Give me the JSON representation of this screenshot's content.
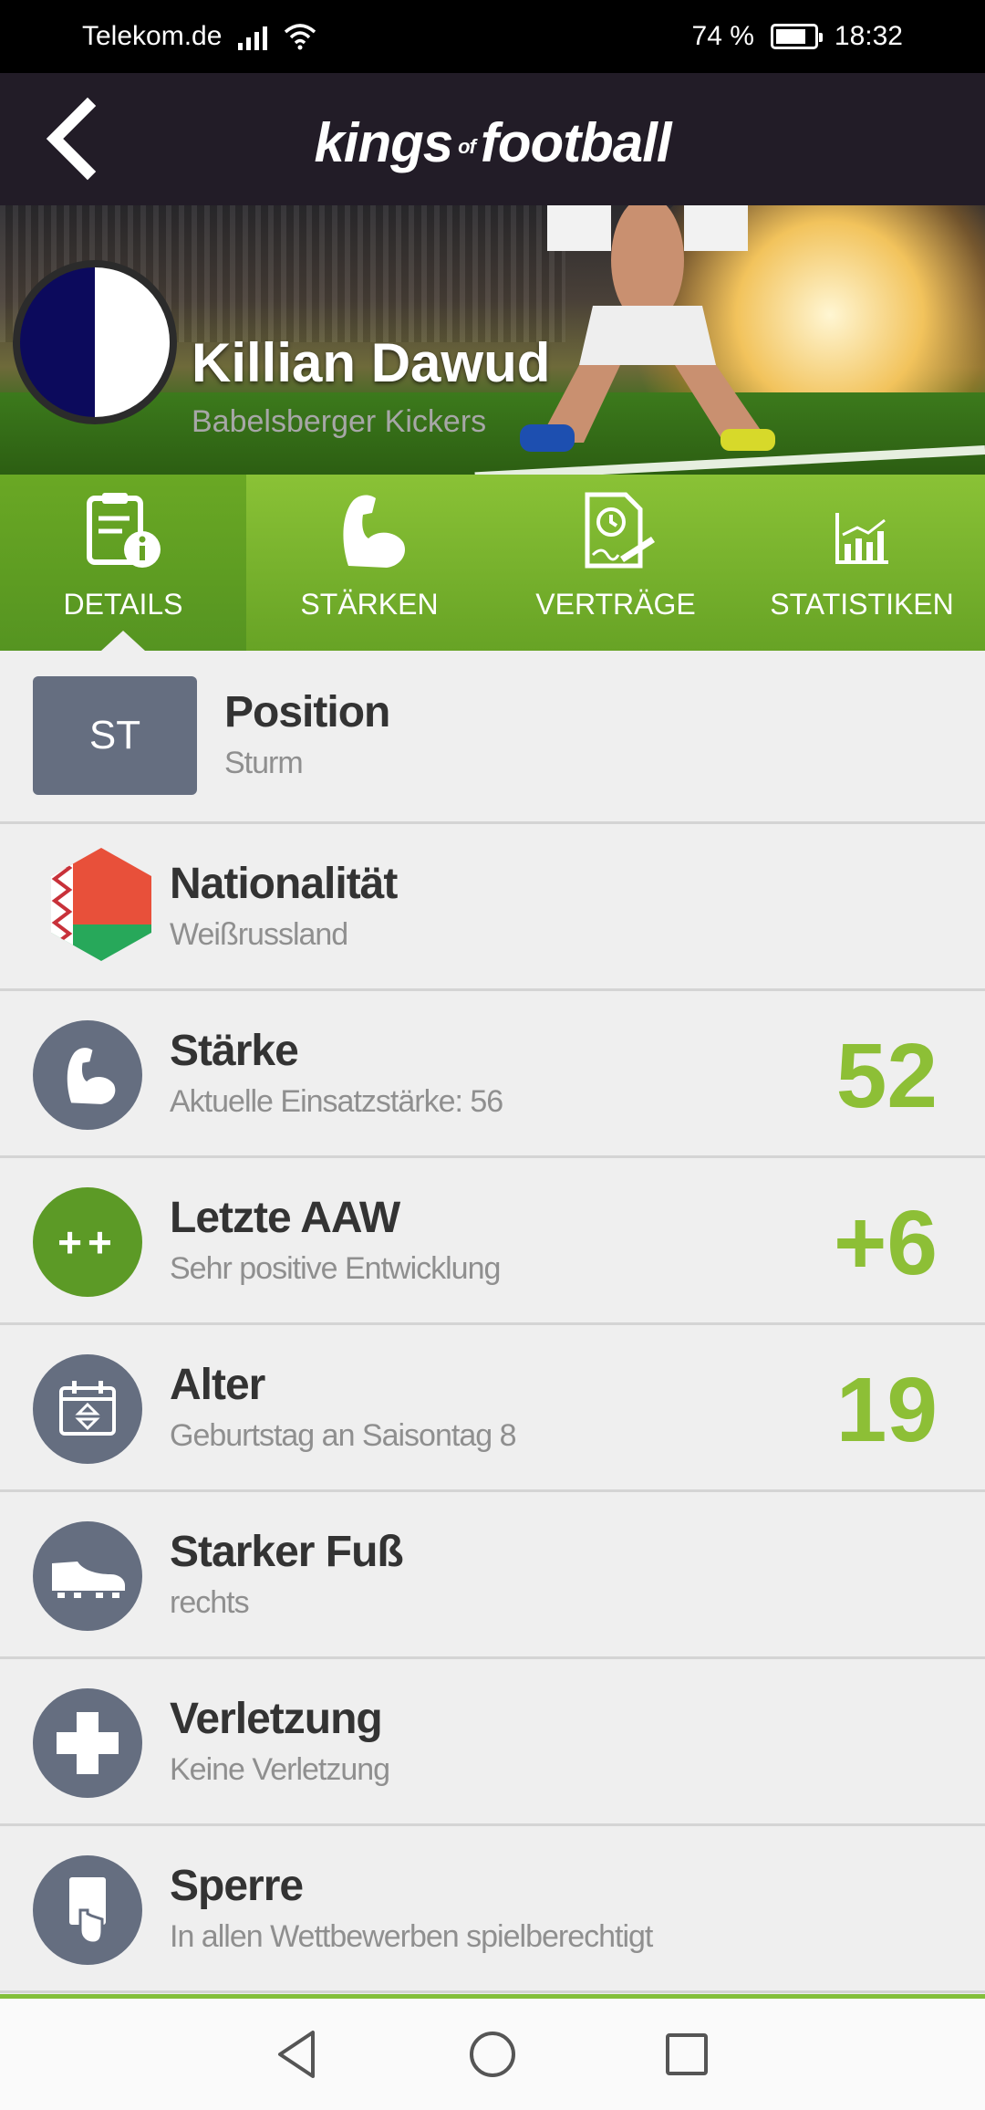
{
  "status_bar": {
    "carrier": "Telekom.de",
    "battery": "74 %",
    "time": "18:32"
  },
  "app": {
    "logo_main": "kings",
    "logo_of": "of",
    "logo_end": "football"
  },
  "player": {
    "name": "Killian Dawud",
    "team": "Babelsberger Kickers"
  },
  "tabs": [
    {
      "label": "DETAILS",
      "icon": "details-icon",
      "active": true
    },
    {
      "label": "STÄRKEN",
      "icon": "strength-arm-icon",
      "active": false
    },
    {
      "label": "VERTRÄGE",
      "icon": "contract-icon",
      "active": false
    },
    {
      "label": "STATISTIKEN",
      "icon": "chart-icon",
      "active": false
    }
  ],
  "details": {
    "position": {
      "badge": "ST",
      "title": "Position",
      "sub": "Sturm"
    },
    "nationality": {
      "title": "Nationalität",
      "sub": "Weißrussland"
    },
    "strength": {
      "title": "Stärke",
      "sub": "Aktuelle Einsatzstärke: 56",
      "value": "52"
    },
    "last_aaw": {
      "icon_text": "++",
      "title": "Letzte AAW",
      "sub": "Sehr positive Entwicklung",
      "value": "+6"
    },
    "age": {
      "title": "Alter",
      "sub": "Geburtstag an Saisontag 8",
      "value": "19"
    },
    "foot": {
      "title": "Starker Fuß",
      "sub": "rechts"
    },
    "injury": {
      "title": "Verletzung",
      "sub": "Keine Verletzung"
    },
    "ban": {
      "title": "Sperre",
      "sub": "In allen Wettbewerben spielberechtigt"
    }
  },
  "colors": {
    "accent_green": "#8dbf36",
    "header_dark": "#221c27",
    "icon_gray": "#656e80"
  }
}
